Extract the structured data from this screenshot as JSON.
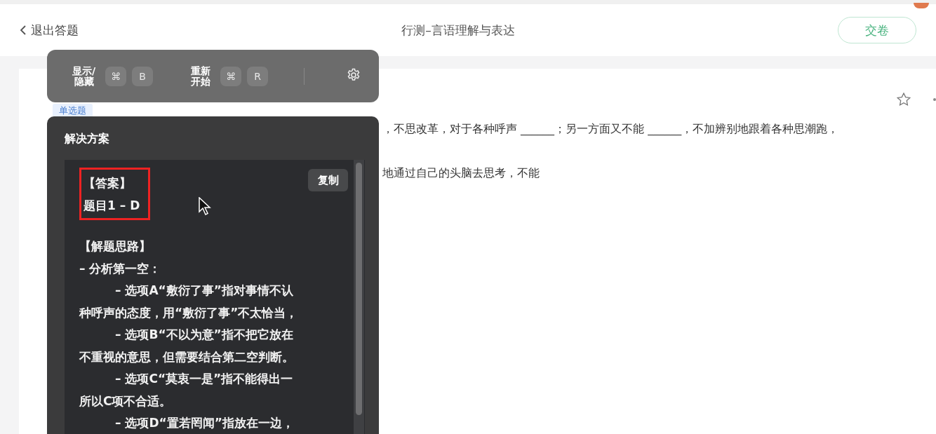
{
  "header": {
    "back_label": "退出答题",
    "title": "行测–言语理解与表达",
    "submit_button": "交卷"
  },
  "toolbar": {
    "shortcuts": [
      {
        "label": [
          "显示/",
          "隐藏"
        ],
        "keys": [
          "⌘",
          "B"
        ]
      },
      {
        "label": [
          "重新",
          "开始"
        ],
        "keys": [
          "⌘",
          "R"
        ]
      }
    ]
  },
  "question": {
    "type_tag": "单选题",
    "starred": false,
    "lines": [
      "，不思改革，对于各种呼声 ______；另一方面又不能 ______，不加辨别地跟着各种思潮跑，",
      "地通过自己的头脑去思考，不能"
    ]
  },
  "solution_panel": {
    "title": "解决方案",
    "copy_button": "复制",
    "answer_heading": "【答案】",
    "answer_value": "题目1 – D",
    "reasoning_heading": "【解题思路】",
    "lines": [
      {
        "kind": "point",
        "text": "– 分析第一空："
      },
      {
        "kind": "sub",
        "text": "– 选项A“敷衍了事”指对事情不认"
      },
      {
        "kind": "cont",
        "text": "种呼声的态度，用“敷衍了事”不太恰当，"
      },
      {
        "kind": "sub",
        "text": "– 选项B“不以为意”指不把它放在"
      },
      {
        "kind": "cont",
        "text": "不重视的意思，但需要结合第二空判断。"
      },
      {
        "kind": "sub",
        "text": "– 选项C“莫衷一是”指不能得出一"
      },
      {
        "kind": "cont",
        "text": "所以C项不合适。"
      },
      {
        "kind": "sub",
        "text": "– 选项D“置若罔闻”指放在一边，"
      }
    ]
  }
}
